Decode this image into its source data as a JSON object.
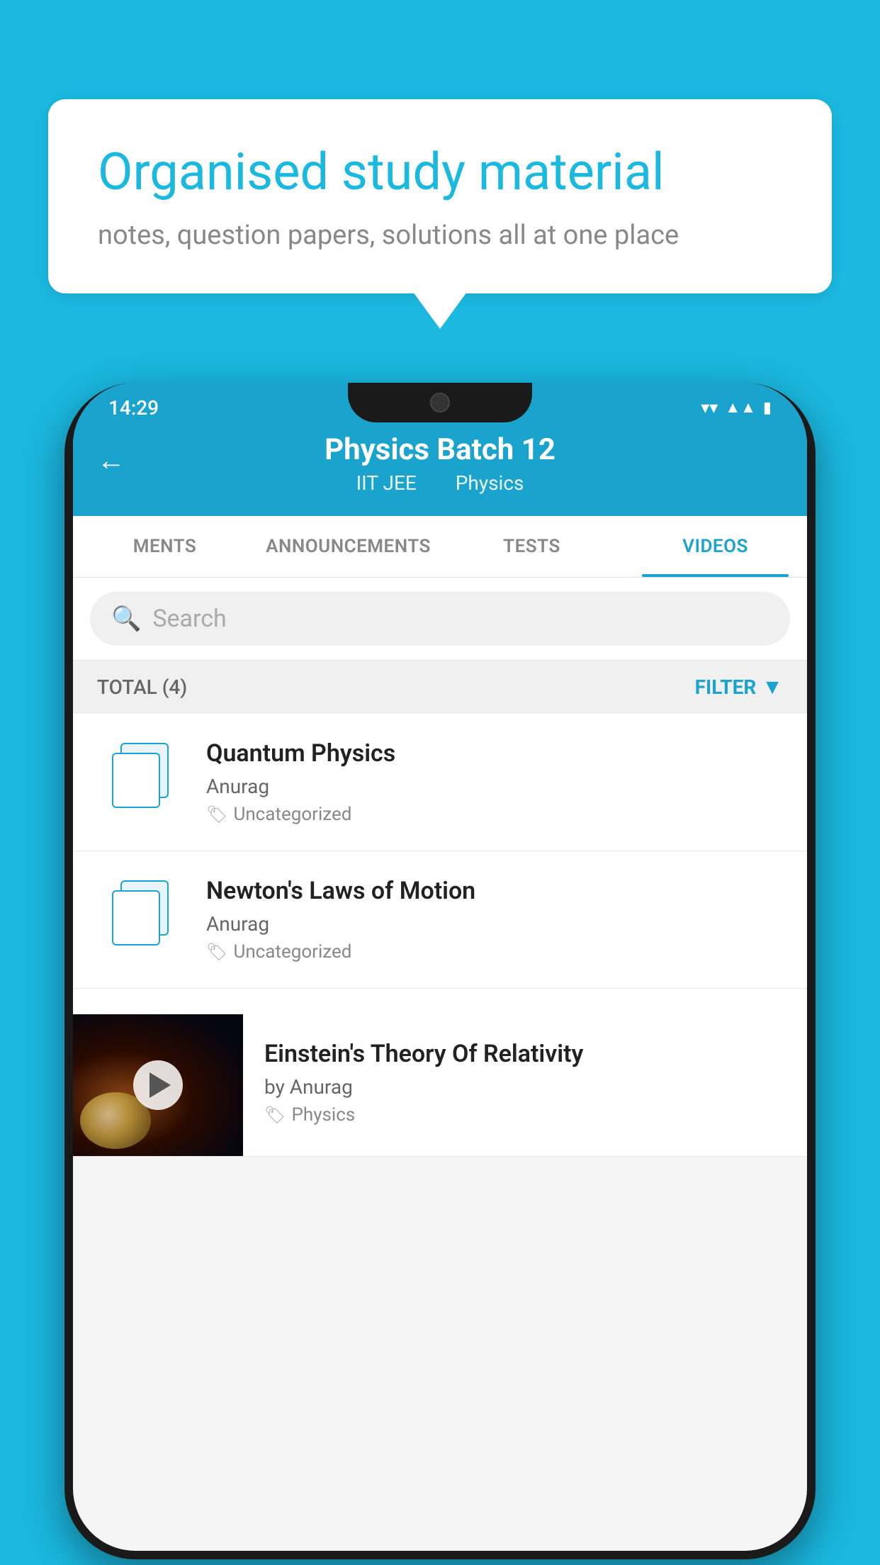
{
  "background": {
    "color": "#1bb8e0"
  },
  "speech_bubble": {
    "title": "Organised study material",
    "subtitle": "notes, question papers, solutions all at one place"
  },
  "phone": {
    "status_bar": {
      "time": "14:29"
    },
    "header": {
      "title": "Physics Batch 12",
      "subtitle_part1": "IIT JEE",
      "subtitle_part2": "Physics",
      "back_label": "←"
    },
    "tabs": [
      {
        "label": "MENTS",
        "active": false
      },
      {
        "label": "ANNOUNCEMENTS",
        "active": false
      },
      {
        "label": "TESTS",
        "active": false
      },
      {
        "label": "VIDEOS",
        "active": true
      }
    ],
    "search": {
      "placeholder": "Search"
    },
    "filter_bar": {
      "total_label": "TOTAL (4)",
      "filter_label": "FILTER"
    },
    "videos": [
      {
        "id": 1,
        "title": "Quantum Physics",
        "author": "Anurag",
        "tag": "Uncategorized",
        "has_thumbnail": false
      },
      {
        "id": 2,
        "title": "Newton's Laws of Motion",
        "author": "Anurag",
        "tag": "Uncategorized",
        "has_thumbnail": false
      },
      {
        "id": 3,
        "title": "Einstein's Theory Of Relativity",
        "author": "by Anurag",
        "tag": "Physics",
        "has_thumbnail": true
      }
    ]
  }
}
